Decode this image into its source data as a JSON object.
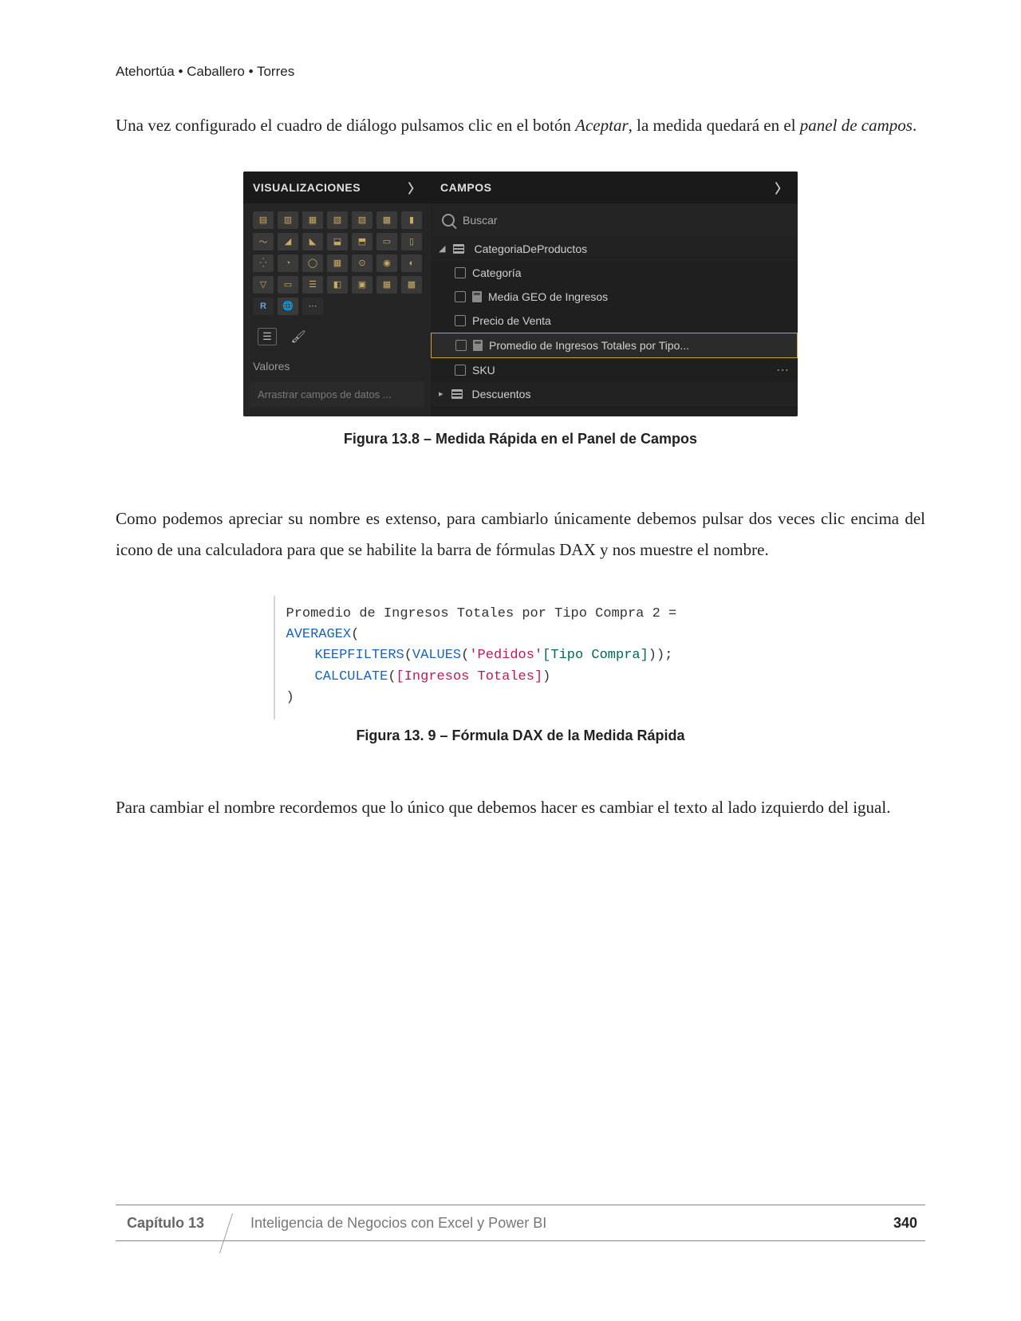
{
  "header": {
    "authors": "Atehortúa • Caballero • Torres"
  },
  "para1_a": "Una vez configurado el cuadro de diálogo pulsamos clic en el botón ",
  "para1_b": "Aceptar",
  "para1_c": ", la medida quedará en el ",
  "para1_d": "panel de campos",
  "para1_e": ".",
  "pbi": {
    "viz_header": "VISUALIZACIONES",
    "campos_header": "CAMPOS",
    "search_placeholder": "Buscar",
    "values_label": "Valores",
    "drag_hint": "Arrastrar campos de datos ...",
    "table1": "CategoriaDeProductos",
    "fields": {
      "f1": "Categoría",
      "f2": "Media GEO de Ingresos",
      "f3": "Precio de Venta",
      "f4": "Promedio de Ingresos Totales por Tipo...",
      "f5": "SKU"
    },
    "table2": "Descuentos"
  },
  "caption1": "Figura 13.8 – Medida Rápida en el Panel de Campos",
  "para2": "Como podemos apreciar su nombre es extenso, para cambiarlo únicamente debemos pulsar dos veces clic encima del icono de una calculadora para que se habilite la barra de fórmulas DAX y nos muestre el nombre.",
  "dax": {
    "line1": "Promedio de Ingresos Totales por Tipo Compra 2 =",
    "fn_avg": "AVERAGEX",
    "fn_keep": "KEEPFILTERS",
    "fn_values": "VALUES",
    "tbl_lit": "'Pedidos'",
    "col_lit": "[Tipo Compra]",
    "fn_calc": "CALCULATE",
    "meas_lit": "[Ingresos Totales]"
  },
  "caption2": "Figura 13. 9 – Fórmula DAX de la Medida Rápida",
  "para3": "Para cambiar el nombre recordemos que lo único que debemos hacer es cambiar el texto al lado izquierdo del igual.",
  "footer": {
    "chapter": "Capítulo 13",
    "title": "Inteligencia de Negocios con Excel y Power BI",
    "page": "340"
  }
}
